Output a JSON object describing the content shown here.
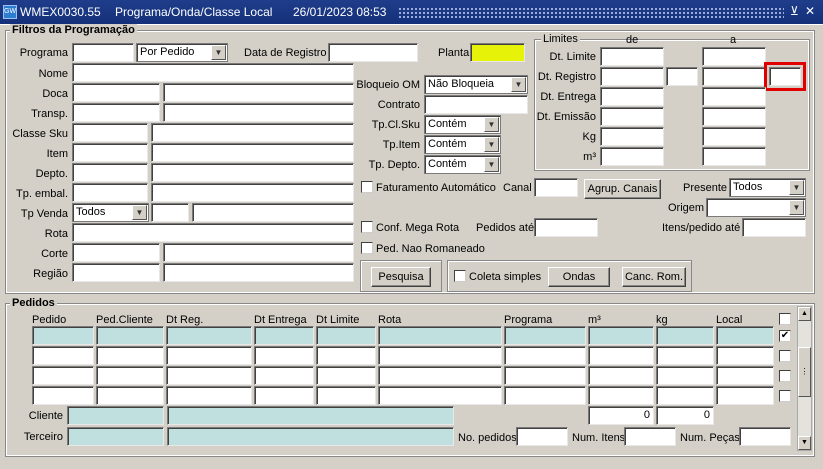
{
  "window": {
    "app_code": "WMEX0030.55",
    "title": "Programa/Onda/Classe Local",
    "datetime": "26/01/2023 08:53",
    "icon_text": "GW",
    "minimize_glyph": "⊻",
    "close_glyph": "✕"
  },
  "filtros": {
    "legend": "Filtros da Programação",
    "programa_label": "Programa",
    "programa_value": "",
    "programa_tipo": "Por Pedido",
    "data_registro_label": "Data de Registro",
    "data_registro_value": "",
    "planta_label": "Planta",
    "planta_value": "",
    "nome_label": "Nome",
    "doca_label": "Doca",
    "transp_label": "Transp.",
    "classe_sku_label": "Classe Sku",
    "item_label": "Item",
    "depto_label": "Depto.",
    "tp_embal_label": "Tp. embal.",
    "tp_venda_label": "Tp Venda",
    "tp_venda_value": "Todos",
    "rota_label": "Rota",
    "corte_label": "Corte",
    "regiao_label": "Região",
    "bloqueio_om_label": "Bloqueio OM",
    "bloqueio_om_value": "Não Bloqueia",
    "contrato_label": "Contrato",
    "tp_cl_sku_label": "Tp.Cl.Sku",
    "tp_cl_sku_value": "Contém",
    "tp_item_label": "Tp.Item",
    "tp_item_value": "Contém",
    "tp_depto_label": "Tp. Depto.",
    "tp_depto_value": "Contém",
    "faturamento_label": "Faturamento Automático",
    "canal_label": "Canal",
    "agrup_canais_label": "Agrup. Canais",
    "presente_label": "Presente",
    "presente_value": "Todos",
    "origem_label": "Origem",
    "origem_value": "",
    "conf_mega_rota_label": "Conf. Mega Rota",
    "pedidos_ate_label": "Pedidos até",
    "itens_pedido_ate_label": "Itens/pedido até",
    "ped_nao_romaneado_label": "Ped. Nao Romaneado",
    "pesquisa_label": "Pesquisa",
    "coleta_simples_label": "Coleta simples",
    "ondas_label": "Ondas",
    "canc_rom_label": "Canc. Rom."
  },
  "limites": {
    "legend": "Limites",
    "de_label": "de",
    "a_label": "a",
    "dt_limite_label": "Dt. Limite",
    "dt_registro_label": "Dt. Registro",
    "dt_entrega_label": "Dt. Entrega",
    "dt_emissao_label": "Dt. Emissão",
    "kg_label": "Kg",
    "m3_label": "m³"
  },
  "pedidos": {
    "legend": "Pedidos",
    "columns": [
      "Pedido",
      "Ped.Cliente",
      "Dt Reg.",
      "Dt Entrega",
      "Dt Limite",
      "Rota",
      "Programa",
      "m³",
      "kg",
      "Local"
    ],
    "row_checks": [
      "",
      "✔",
      "",
      "",
      ""
    ],
    "cliente_label": "Cliente",
    "terceiro_label": "Terceiro",
    "total_m3": "0",
    "total_kg": "0",
    "no_pedidos_label": "No. pedidos",
    "num_itens_label": "Num. Itens",
    "num_pecas_label": "Num. Peças"
  }
}
